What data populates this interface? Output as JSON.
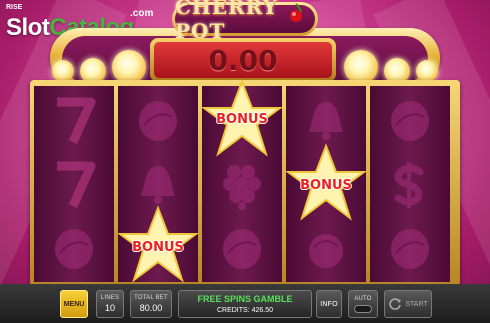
{
  "watermark": {
    "prefix": "RISE",
    "brand_a": "Slot",
    "brand_b": "Catalog",
    "suffix": ".com"
  },
  "header": {
    "title": "CHERRY POT",
    "win_amount": "0.00"
  },
  "reels": [
    [
      "seven",
      "seven",
      "plum"
    ],
    [
      "plum",
      "bell",
      "bonus"
    ],
    [
      "bonus",
      "grapes",
      "plum"
    ],
    [
      "bell",
      "bonus",
      "cherry"
    ],
    [
      "plum",
      "dollar",
      "plum"
    ]
  ],
  "bonus_label": "BONUS",
  "controls": {
    "menu": "MENU",
    "lines_label": "LINES",
    "lines_value": "10",
    "total_bet_label": "TOTAL BET",
    "total_bet_value": "80.00",
    "feature_text": "FREE SPINS GAMBLE",
    "credits_label": "CREDITS:",
    "credits_value": "426.50",
    "info": "INFO",
    "auto": "AUTO",
    "start": "START"
  },
  "colors": {
    "accent_gold": "#f6d236",
    "win_red": "#e23a3a",
    "feature_green": "#58e05a"
  }
}
